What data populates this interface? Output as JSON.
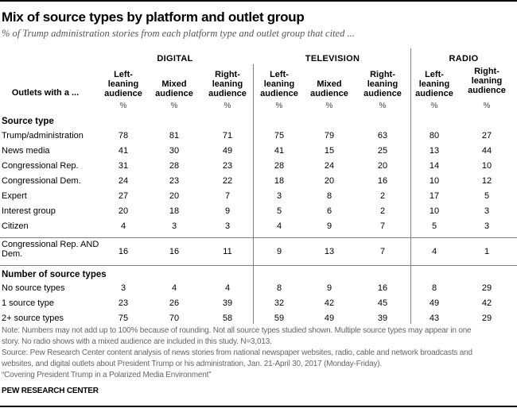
{
  "title": "Mix of source types by platform and outlet group",
  "subtitle": "% of Trump administration stories from each platform type and outlet group that cited ...",
  "row_header_label": "Outlets with a ...",
  "percent_symbol": "%",
  "groups": [
    {
      "label": "DIGITAL"
    },
    {
      "label": "TELEVISION"
    },
    {
      "label": "RADIO"
    }
  ],
  "columns": [
    {
      "group": "DIGITAL",
      "lines": [
        "Left-",
        "leaning",
        "audience"
      ]
    },
    {
      "group": "DIGITAL",
      "lines": [
        "Mixed",
        "audience"
      ]
    },
    {
      "group": "DIGITAL",
      "lines": [
        "Right-",
        "leaning",
        "audience"
      ]
    },
    {
      "group": "TELEVISION",
      "lines": [
        "Left-",
        "leaning",
        "audience"
      ]
    },
    {
      "group": "TELEVISION",
      "lines": [
        "Mixed",
        "audience"
      ]
    },
    {
      "group": "TELEVISION",
      "lines": [
        "Right-",
        "leaning",
        "audience"
      ]
    },
    {
      "group": "RADIO",
      "lines": [
        "Left-",
        "leaning",
        "audience"
      ]
    },
    {
      "group": "RADIO",
      "lines": [
        "Right-",
        "leaning",
        "audience"
      ]
    }
  ],
  "sections": {
    "source_type": "Source type",
    "number_of_source_types": "Number of source types"
  },
  "chart_data": {
    "type": "table",
    "title": "Mix of source types by platform and outlet group",
    "subtitle": "% of Trump administration stories from each platform type and outlet group that cited ...",
    "column_headers": [
      "Digital: Left-leaning audience",
      "Digital: Mixed audience",
      "Digital: Right-leaning audience",
      "Television: Left-leaning audience",
      "Television: Mixed audience",
      "Television: Right-leaning audience",
      "Radio: Left-leaning audience",
      "Radio: Right-leaning audience"
    ],
    "unit": "%",
    "rows": [
      {
        "section": "Source type",
        "label": "Trump/administration",
        "values": [
          78,
          81,
          71,
          75,
          79,
          63,
          80,
          27
        ]
      },
      {
        "section": "Source type",
        "label": "News media",
        "values": [
          41,
          30,
          49,
          41,
          15,
          25,
          13,
          44
        ]
      },
      {
        "section": "Source type",
        "label": "Congressional Rep.",
        "values": [
          31,
          28,
          23,
          28,
          24,
          20,
          14,
          10
        ]
      },
      {
        "section": "Source type",
        "label": "Congressional Dem.",
        "values": [
          24,
          23,
          22,
          18,
          20,
          16,
          10,
          12
        ]
      },
      {
        "section": "Source type",
        "label": "Expert",
        "values": [
          27,
          20,
          7,
          3,
          8,
          2,
          17,
          5
        ]
      },
      {
        "section": "Source type",
        "label": "Interest group",
        "values": [
          20,
          18,
          9,
          5,
          6,
          2,
          10,
          3
        ]
      },
      {
        "section": "Source type",
        "label": "Citizen",
        "values": [
          4,
          3,
          3,
          4,
          9,
          7,
          5,
          3
        ]
      },
      {
        "section": "",
        "label_lines": [
          "Congressional Rep. AND",
          "Dem."
        ],
        "label": "Congressional Rep. AND Dem.",
        "values": [
          16,
          16,
          11,
          9,
          13,
          7,
          4,
          1
        ]
      },
      {
        "section": "Number of source types",
        "label": "No source types",
        "values": [
          3,
          4,
          4,
          8,
          9,
          16,
          8,
          29
        ]
      },
      {
        "section": "Number of source types",
        "label": "1 source type",
        "values": [
          23,
          26,
          39,
          32,
          42,
          45,
          49,
          42
        ]
      },
      {
        "section": "Number of source types",
        "label": "2+ source types",
        "values": [
          75,
          70,
          58,
          59,
          49,
          39,
          43,
          29
        ]
      }
    ]
  },
  "notes": [
    "Note: Numbers may not add up to 100% because of rounding. Not all source types studied shown. Multiple source types may appear in one",
    "story. No radio shows with a mixed audience are included in this study. N=3,013.",
    "Source: Pew Research Center content analysis of news stories from national newspaper websites, radio, cable and network broadcasts and",
    "websites, and digital outlets about President Trump or his administration, Jan. 21-April 30, 2017 (Monday-Friday).",
    "“Covering President Trump in a Polarized Media Environment”"
  ],
  "brand": "PEW RESEARCH CENTER"
}
